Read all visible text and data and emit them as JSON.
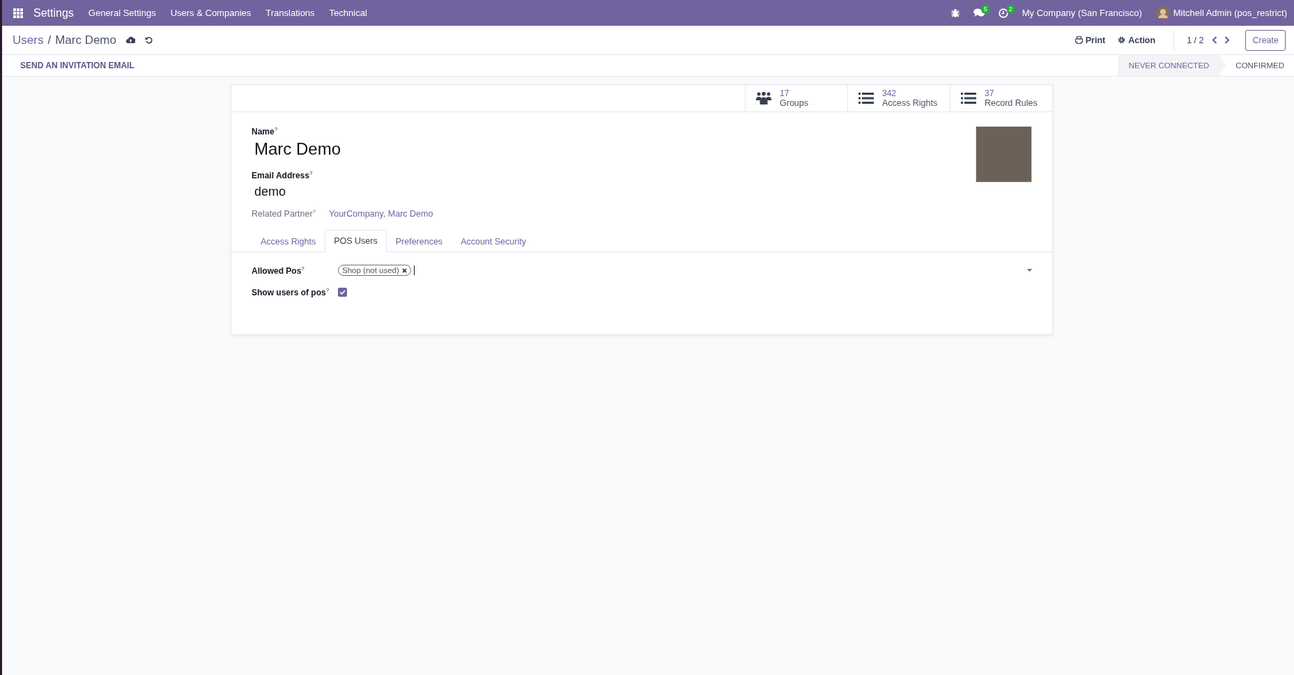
{
  "navbar": {
    "app_name": "Settings",
    "menu": [
      "General Settings",
      "Users & Companies",
      "Translations",
      "Technical"
    ],
    "messages_badge": "5",
    "activities_badge": "2",
    "company": "My Company (San Francisco)",
    "user": "Mitchell Admin (pos_restrict)"
  },
  "breadcrumb": {
    "parent": "Users",
    "separator": "/",
    "current": "Marc Demo"
  },
  "toolbar": {
    "print": "Print",
    "action": "Action",
    "pager": "1 / 2",
    "create": "Create"
  },
  "statusbar": {
    "button": "SEND AN INVITATION EMAIL",
    "stages": [
      {
        "label": "NEVER CONNECTED",
        "selected": true
      },
      {
        "label": "CONFIRMED",
        "selected": false
      }
    ]
  },
  "smart_buttons": [
    {
      "kind": "groups",
      "count": "17",
      "label": "Groups"
    },
    {
      "kind": "list",
      "count": "342",
      "label": "Access Rights"
    },
    {
      "kind": "list",
      "count": "37",
      "label": "Record Rules"
    }
  ],
  "form": {
    "name_label": "Name$^{?}$",
    "name": "Marc Demo",
    "email_label": "Email Address$^{?}$",
    "email": "demo",
    "partner_label": "Related Partner$^{?}$",
    "partner": "YourCompany, Marc Demo"
  },
  "tabs": [
    {
      "label": "Access Rights",
      "selected": false
    },
    {
      "label": "POS Users",
      "selected": true
    },
    {
      "label": "Preferences",
      "selected": false
    },
    {
      "label": "Account Security",
      "selected": false
    }
  ],
  "fields": [
    {
      "kind": "tags",
      "label": "Allowed Pos$^{?}$",
      "tags": [
        "Shop (not used)"
      ]
    },
    {
      "kind": "checkbox",
      "label": "Show users of pos$^{?}$",
      "checked": true
    }
  ]
}
